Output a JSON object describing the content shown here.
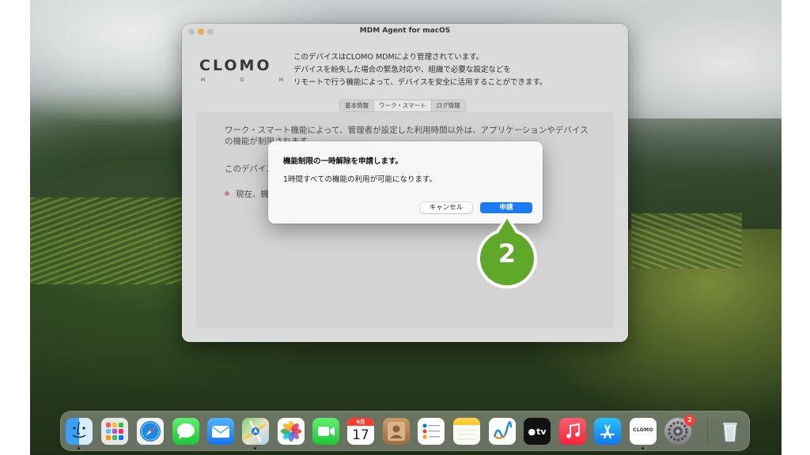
{
  "window": {
    "title": "MDM Agent for macOS",
    "logo_text": "CLOMO",
    "logo_sub": [
      "M",
      "D",
      "M"
    ],
    "description": [
      "このデバイスはCLOMO MDMにより管理されています。",
      "デバイスを紛失した場合の緊急対応や、組織で必要な設定などを",
      "リモートで行う機能によって、デバイスを安全に活用することができます。"
    ],
    "tabs": [
      {
        "label": "基本情報",
        "active": false
      },
      {
        "label": "ワーク・スマート",
        "active": true
      },
      {
        "label": "ログ情報",
        "active": false
      }
    ],
    "content": {
      "text1": "ワーク・スマート機能によって、管理者が設定した利用時間以外は、アプリケーションやデバイスの機能が制限されます。",
      "text2": "このデバイス",
      "item1": "現在、機"
    }
  },
  "alert": {
    "title": "機能制限の一時解除を申請します。",
    "message": "1時間すべての機能の利用が可能になります。",
    "cancel_label": "キャンセル",
    "apply_label": "申請"
  },
  "callout": {
    "number": "2",
    "color": "#5fa82a"
  },
  "dock": {
    "calendar": {
      "month": "6月",
      "day": "17"
    },
    "settings_badge": "2",
    "tv_label": "tv",
    "items": [
      "finder-icon",
      "launchpad-icon",
      "safari-icon",
      "messages-icon",
      "mail-icon",
      "maps-icon",
      "photos-icon",
      "facetime-icon",
      "calendar-icon",
      "contacts-icon",
      "reminders-icon",
      "notes-icon",
      "freeform-icon",
      "apple-tv-icon",
      "music-icon",
      "app-store-icon",
      "clomo-icon",
      "system-settings-icon",
      "trash-icon"
    ]
  }
}
